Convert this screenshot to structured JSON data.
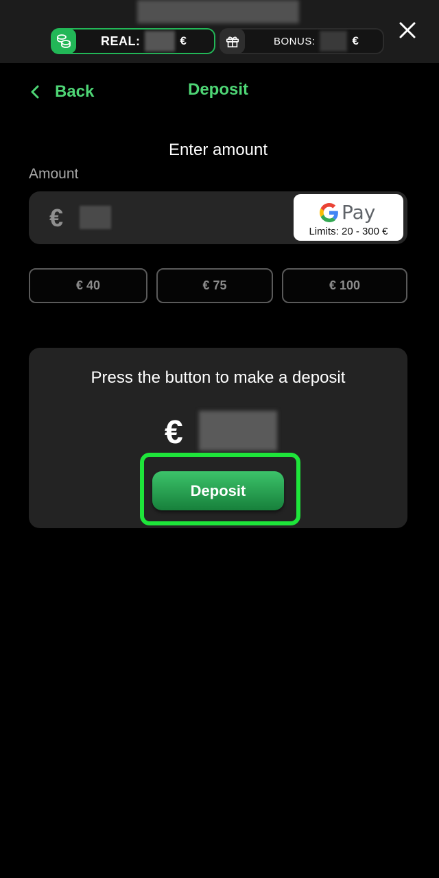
{
  "header": {
    "real_label": "REAL:",
    "real_currency": "€",
    "bonus_label": "BONUS:",
    "bonus_currency": "€"
  },
  "nav": {
    "back_label": "Back",
    "title": "Deposit"
  },
  "form": {
    "heading": "Enter amount",
    "amount_label": "Amount",
    "currency_symbol": "€",
    "payment_method": {
      "name": "Google Pay",
      "pay_text": "Pay",
      "limits": "Limits: 20 - 300 €"
    },
    "quick_amounts": [
      "€ 40",
      "€ 75",
      "€ 100"
    ]
  },
  "confirm": {
    "prompt": "Press the button to make a deposit",
    "currency_symbol": "€",
    "deposit_button": "Deposit"
  },
  "colors": {
    "accent_green": "#4ed575",
    "button_green": "#22b757",
    "highlight": "#1ee53a"
  },
  "icons": {
    "real": "coins-icon",
    "bonus": "gift-icon",
    "close": "close-icon",
    "back": "chevron-left-icon",
    "gpay": "google-g-icon"
  }
}
